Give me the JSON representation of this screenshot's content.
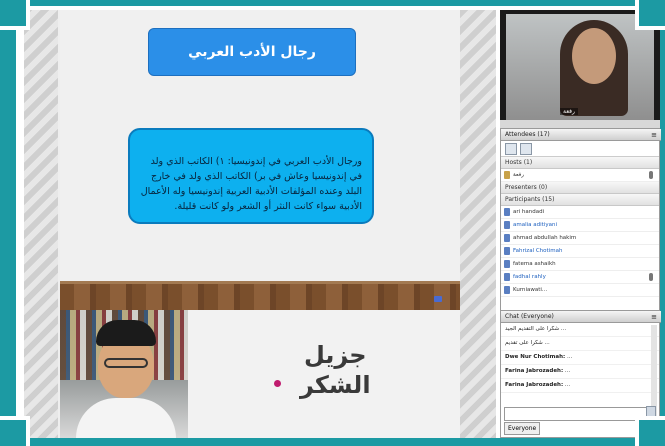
{
  "slide": {
    "title": "رجال الأدب العربي",
    "body": "ورجال الأدب العربي في إندونيسيا: ١) الكاتب الذي ولد في إندونيسيا وعاش في بر) الكاتب الذي ولد في خارج البلد وعنده المؤلفات الأدبية العربية إندونيسيا وله الأعمال الأدبية سواء كانت النثر أو الشعر ولو كانت قليلة."
  },
  "presenter": {
    "thanks_line1": "جزيل",
    "thanks_line2": "الشكر"
  },
  "right_panel": {
    "webcam_name": "رفعة",
    "attendees": {
      "header": "Attendees (17)",
      "hosts_group": "Hosts (1)",
      "hosts": [
        "رفعة"
      ],
      "presenters_group": "Presenters (0)",
      "participants_group": "Participants (15)",
      "participants": [
        "ari handadi",
        "amalia aditiyani",
        "ahmad abdullah hakim",
        "Fahrizal Chotimah",
        "fatema ashaikh",
        "fadhal rahly",
        "Kurniawati..."
      ]
    },
    "chat": {
      "header": "Chat",
      "header_suffix": "(Everyone)",
      "messages": [
        {
          "sender": "",
          "text": "شكرا على التقديم الجيد ..."
        },
        {
          "sender": "",
          "text": "شكرا على تقديم ..."
        },
        {
          "sender": "Dwe Nur Chotimah:",
          "text": "..."
        },
        {
          "sender": "Farina Jabrozadeh:",
          "text": "..."
        },
        {
          "sender": "Farina Jabrozadeh:",
          "text": "..."
        }
      ],
      "footer": "Everyone"
    }
  }
}
